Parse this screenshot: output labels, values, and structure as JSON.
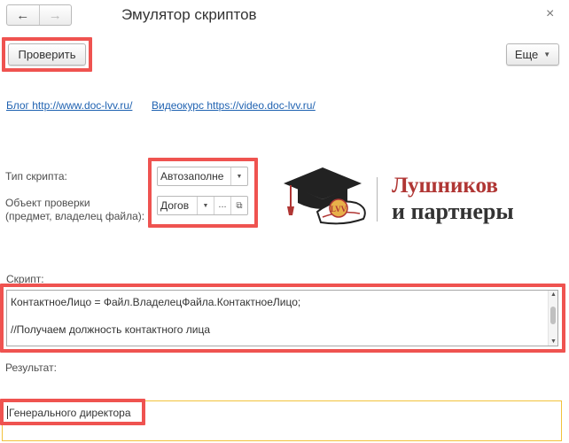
{
  "window": {
    "title": "Эмулятор скриптов",
    "close_glyph": "×"
  },
  "nav": {
    "back_icon": "arrow-left-icon",
    "forward_icon": "arrow-right-icon"
  },
  "toolbar": {
    "check_label": "Проверить",
    "more_label": "Еще"
  },
  "links": {
    "blog": "Блог http://www.doc-lvv.ru/",
    "course": "Видеокурс https://video.doc-lvv.ru/"
  },
  "form": {
    "script_type_label": "Тип скрипта:",
    "script_type_value": "Автозаполне",
    "check_object_label_line1": "Объект проверки",
    "check_object_label_line2": "(предмет, владелец файла):",
    "check_object_value": "Догов",
    "select_dots": "..."
  },
  "logo": {
    "badge_text": "LVV",
    "name_line1": "Лушников",
    "name_line2": "и партнеры",
    "accent_color": "#b03634"
  },
  "script": {
    "label": "Скрипт:",
    "lines": [
      "КонтактноеЛицо = Файл.ВладелецФайла.КонтактноеЛицо;",
      "//Получаем должность контактного лица"
    ]
  },
  "result": {
    "label": "Результат:",
    "value": "Генерального директора"
  },
  "highlight_color": "#ef5350"
}
